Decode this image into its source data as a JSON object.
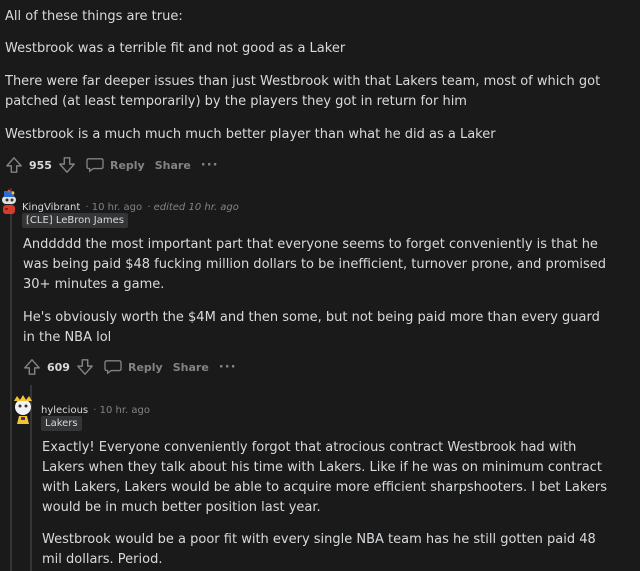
{
  "top_comment": {
    "paragraphs": [
      "All of these things are true:",
      "Westbrook was a terrible fit and not good as a Laker",
      "There were far deeper issues than just Westbrook with that Lakers team, most of which got patched (at least temporarily) by the players they got in return for him",
      "Westbrook is a much much much better player than what he did as a Laker"
    ],
    "votes": "955",
    "reply_label": "Reply",
    "share_label": "Share",
    "more_label": "···"
  },
  "comment2": {
    "username": "KingVibrant",
    "time": "· 10 hr. ago",
    "edited": "· edited 10 hr. ago",
    "flair": "[CLE] LeBron James",
    "paragraphs": [
      "Anddddd the most important part that everyone seems to forget conveniently is that he was being paid $48 fucking million dollars to be inefficient, turnover prone, and promised 30+ minutes a game.",
      "He's obviously worth the $4M and then some, but not being paid more than every guard in the NBA lol"
    ],
    "votes": "609",
    "reply_label": "Reply",
    "share_label": "Share",
    "more_label": "···"
  },
  "comment3": {
    "username": "hylecious",
    "time": "· 10 hr. ago",
    "flair": "Lakers",
    "paragraphs": [
      "Exactly! Everyone conveniently forgot that atrocious contract Westbrook had with Lakers when they talk about his time with Lakers. Like if he was on minimum contract with Lakers, Lakers would be able to acquire more efficient sharpshooters. I bet Lakers would be in much better position last year.",
      "Westbrook would be a poor fit with every single NBA team has he still gotten paid 48 mil dollars. Period."
    ]
  }
}
